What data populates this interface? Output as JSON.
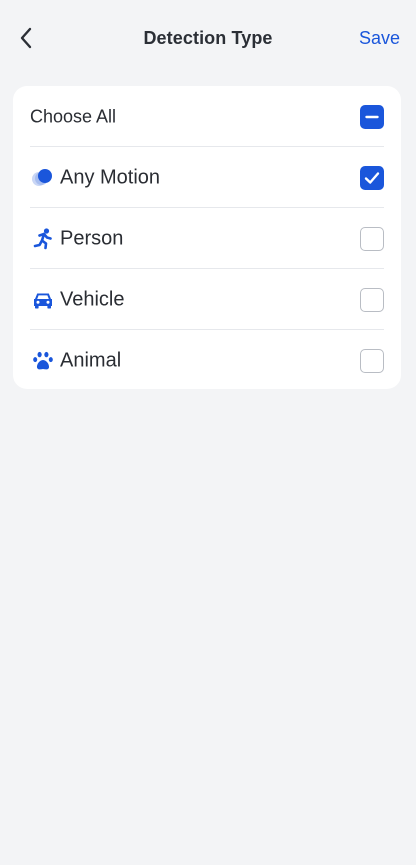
{
  "header": {
    "title": "Detection Type",
    "save_label": "Save",
    "back_icon": "chevron-left-icon"
  },
  "colors": {
    "accent": "#1a56db",
    "background": "#f3f4f6",
    "card": "#ffffff",
    "checkbox_border": "#b9bdc4"
  },
  "options": [
    {
      "label": "Choose All",
      "icon": null,
      "state": "indeterminate"
    },
    {
      "label": "Any Motion",
      "icon": "motion-icon",
      "state": "checked"
    },
    {
      "label": "Person",
      "icon": "running-person-icon",
      "state": "unchecked"
    },
    {
      "label": "Vehicle",
      "icon": "car-icon",
      "state": "unchecked"
    },
    {
      "label": "Animal",
      "icon": "paw-icon",
      "state": "unchecked"
    }
  ]
}
